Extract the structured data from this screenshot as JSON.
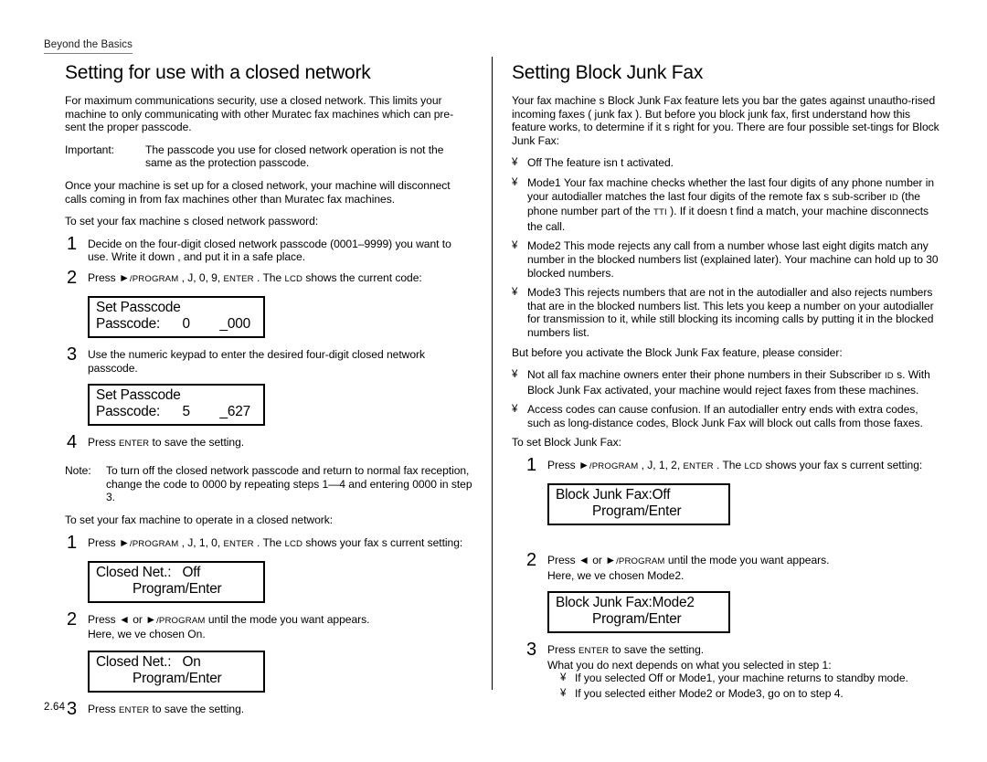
{
  "running_head": "Beyond the Basics",
  "folio": "2.64",
  "left_column": {
    "title": "Setting for use with a closed network",
    "intro": "For maximum communications security, use a    closed network. This limits your machine to only communicating with other Muratec fax machines which can  pre-sent  the proper passcode.",
    "important_label": "Important:",
    "important_text": "The passcode you use for closed network operation is   not  the same as the protection passcode.",
    "para2": "Once your machine is set up for a closed network, your machine will disconnect calls coming in from fax machines other than Muratec fax machines.",
    "lead1": "To set your fax machine s closed network password:",
    "step1_num": "1",
    "step1_text": "Decide on the four-digit closed network passcode   (0001–9999) you want to use. Write it down    , and put it in a safe place.",
    "step2_num": "2",
    "step2_press": "Press ",
    "step2_arrow": "►",
    "step2_program": "/program",
    "step2_mid": " , J, 0, 9, ",
    "step2_enter": "enter",
    "step2_tail1": " . The ",
    "step2_lcd": "lcd",
    "step2_tail2": " shows the current code:",
    "lcd1_line1": "Set Passcode",
    "lcd1_line2": "Passcode:      0        _000",
    "step3_num": "3",
    "step3_text": "Use the numeric keypad to enter the desired four-digit    closed network passcode.",
    "lcd2_line1": "Set Passcode",
    "lcd2_line2": "Passcode:      5        _627",
    "step4_num": "4",
    "step4_press": "Press ",
    "step4_enter": "enter",
    "step4_tail": " to save the setting.",
    "note_label": "Note:",
    "note_text": "To turn off the closed network passcode and return to normal fax reception, change the code to 0000 by repeating steps 1—4 and entering  0000 in step 3.",
    "lead2": "To set your fax machine to operate in a closed network:",
    "b_step1_num": "1",
    "b_step1_press": "Press ",
    "b_step1_arrow": "►",
    "b_step1_program": "/program",
    "b_step1_mid": " , J, 1, 0, ",
    "b_step1_enter": "enter",
    "b_step1_tail1": " . The ",
    "b_step1_lcd": "lcd",
    "b_step1_tail2": " shows your fax s current setting:",
    "lcd3_line1": "Closed Net.:   Off",
    "lcd3_line2": "Program/Enter",
    "b_step2_num": "2",
    "b_step2_press": "Press ",
    "b_step2_left": "◄",
    "b_step2_or": " or ",
    "b_step2_arrow": "►",
    "b_step2_program": "/program",
    "b_step2_tail": "  until the mode you want appears.",
    "b_step2_line2": "Here, we ve chosen On.",
    "lcd4_line1": "Closed Net.:   On",
    "lcd4_line2": "Program/Enter",
    "b_step3_num": "3",
    "b_step3_press": "Press ",
    "b_step3_enter": "enter",
    "b_step3_tail": " to save the setting."
  },
  "right_column": {
    "title": "Setting Block Junk Fax",
    "intro": "Your fax machine s  Block Junk Fax   feature lets you bar the gates against unautho-rised incoming faxes ( junk fax ). But before you block junk fax, first understand how this feature works, to determine if it s right for you. There are four possible set-tings for Block Junk Fax:",
    "bullet_char": "¥",
    "bullet_off": "Off   The feature isn t activated.",
    "bullet_mode1": "Mode1   Your fax machine checks whether the last four digits of any phone number in your autodialler matches the last four digits of the remote fax s sub-scriber ",
    "bullet_mode1_id": "id",
    "bullet_mode1_b": " (the phone number part of the    ",
    "bullet_mode1_tti": "tti",
    "bullet_mode1_c": " ). If it doesn t find a match, your machine disconnects the call.",
    "bullet_mode2": "Mode2   This mode rejects any call from a number whose last eight digits match any number in the    blocked numbers list  (explained later). Your machine can hold up to 30 blocked numbers.",
    "bullet_mode3": "Mode3   This    rejects numbers that are   not in the autodialler and also rejects numbers  that  are in the blocked numbers list. This lets you keep a number on your autodialler for transmission to it, while still blocking its incoming calls by putting it in the blocked numbers list.",
    "consider_lead": "But before you activate the Block Junk Fax feature, please consider:",
    "bullet_subscriber_a": "Not all fax machine owners enter their phone numbers in their Subscriber       ",
    "bullet_subscriber_id": "id",
    "bullet_subscriber_b": " s. With Block Junk Fax activated, your machine would reject faxes from these machines.",
    "bullet_access": "Access codes can cause confusion. If an autodialler entry ends with extra codes, such as long-distance codes, Block Junk Fax will block out calls from those faxes.",
    "lead": "To set Block Junk Fax:",
    "step1_num": "1",
    "step1_press": "Press ",
    "step1_arrow": "►",
    "step1_program": "/program",
    "step1_mid": " , J, 1, 2, ",
    "step1_enter": "enter",
    "step1_tail1": " . The ",
    "step1_lcd": "lcd",
    "step1_tail2": " shows your fax s current setting:",
    "lcd1_line1": "Block Junk Fax:Off",
    "lcd1_line2": "Program/Enter",
    "step2_num": "2",
    "step2_press": "Press ",
    "step2_left": "◄",
    "step2_or": " or ",
    "step2_arrow": "►",
    "step2_program": "/program",
    "step2_tail": "  until the mode you want appears.",
    "step2_line2": "Here, we ve chosen Mode2.",
    "lcd2_line1": "Block Junk Fax:Mode2",
    "lcd2_line2": "Program/Enter",
    "step3_num": "3",
    "step3_press": "Press ",
    "step3_enter": "enter",
    "step3_tail": " to save the setting.",
    "step3_line2": "What you do next depends on what you selected in step 1:",
    "step3_sub1": "If you selected  Off or Mode1, your machine returns to standby mode.",
    "step3_sub2": "If you selected either    Mode2 or Mode3, go on to step 4."
  }
}
